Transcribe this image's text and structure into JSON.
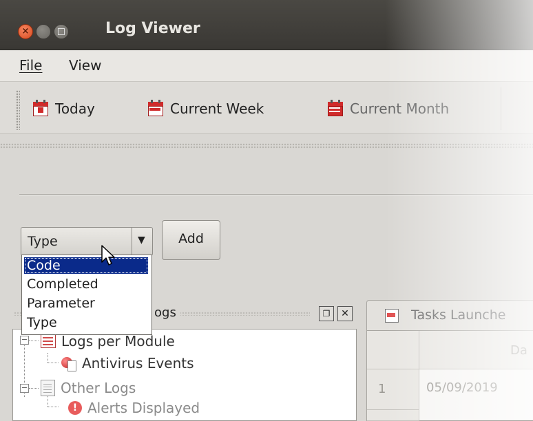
{
  "window": {
    "title": "Log Viewer"
  },
  "menu": {
    "items": [
      "File",
      "View"
    ]
  },
  "toolbar": {
    "buttons": [
      {
        "label": "Today",
        "icon": "calendar-day-icon"
      },
      {
        "label": "Current Week",
        "icon": "calendar-week-icon"
      },
      {
        "label": "Current Month",
        "icon": "calendar-month-icon"
      }
    ]
  },
  "filter": {
    "combo_value": "Type",
    "add_label": "Add",
    "options": [
      "Code",
      "Completed",
      "Parameter",
      "Type"
    ],
    "highlighted": "Code"
  },
  "left_panel": {
    "title_fragment": "ogs",
    "tree": [
      {
        "label": "Logs per Module",
        "icon": "table-icon",
        "level": 0,
        "expanded": true
      },
      {
        "label": "Antivirus Events",
        "icon": "antivirus-icon",
        "level": 1
      },
      {
        "label": "Other Logs",
        "icon": "document-icon",
        "level": 0,
        "expanded": true
      },
      {
        "label": "Alerts Displayed",
        "icon": "alert-icon",
        "level": 1
      }
    ]
  },
  "right_panel": {
    "tab_label": "Tasks Launche",
    "column_header_fragment": "Da",
    "rows": [
      {
        "num": "1",
        "date": "05/09/2019"
      }
    ]
  },
  "colors": {
    "titlebar": "#3a3834",
    "close_button": "#d84a1f",
    "selection": "#0a2a8a",
    "calendar_red": "#d02b2b"
  }
}
